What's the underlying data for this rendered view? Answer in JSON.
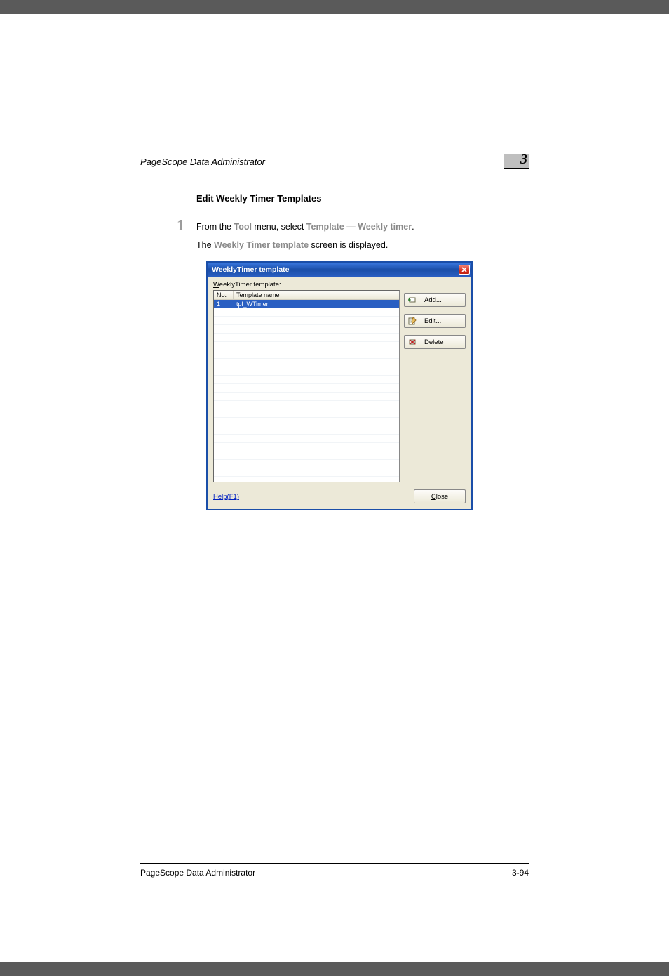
{
  "header": {
    "left": "PageScope Data Administrator",
    "chapter": "3"
  },
  "section_title": "Edit Weekly Timer Templates",
  "step": {
    "num": "1",
    "line1_a": "From the ",
    "line1_tool": "Tool",
    "line1_b": " menu, select ",
    "line1_template": "Template",
    "line1_dash": " — ",
    "line1_weekly": "Weekly timer",
    "line1_end": ".",
    "line2_a": "The ",
    "line2_screen": "Weekly Timer template",
    "line2_b": " screen is displayed."
  },
  "dialog": {
    "title": "WeeklyTimer template",
    "label_prefix": "W",
    "label_rest": "eeklyTimer template:",
    "columns": {
      "no": "No.",
      "name": "Template name"
    },
    "rows": [
      {
        "no": "1",
        "name": "tpl_WTimer"
      }
    ],
    "buttons": {
      "add_u": "A",
      "add_rest": "dd...",
      "edit_prefix": "E",
      "edit_u": "d",
      "edit_rest": "it...",
      "delete_prefix": "De",
      "delete_u": "l",
      "delete_rest": "ete"
    },
    "help": "Help(F1)",
    "close_u": "C",
    "close_rest": "lose"
  },
  "footer": {
    "left": "PageScope Data Administrator",
    "right": "3-94"
  }
}
